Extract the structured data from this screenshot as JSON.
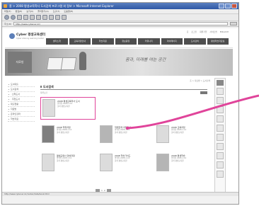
{
  "window": {
    "title": "홈 > 2008 평생교육학사 도서검색 프로그램 외 정보 > Microsoft Internet Explorer",
    "menu": [
      "파일(F)",
      "편집(E)",
      "보기(V)",
      "즐겨찾기(A)",
      "도구(T)",
      "도움말(H)"
    ]
  },
  "address": {
    "label": "주소(D)",
    "url": "http://www.cyber.ac.kr/",
    "go": "이동"
  },
  "site": {
    "logo_text": "Cyber 평생교육센터",
    "logo_sub": "Cyber Lifelong Learning Center",
    "util_links": [
      "홈",
      "로그인",
      "회원가입",
      "사이트맵",
      "ENGLISH"
    ],
    "gnb": [
      "센터소개",
      "교육과정안내",
      "학습지원",
      "정보광장",
      "커뮤니티",
      "마이페이지",
      "도서검색",
      "평생학습자료실"
    ],
    "section_badge": "자료방",
    "slogan": "꿈과, 미래를 여는 공간"
  },
  "lnb": [
    "도서대출",
    "도서검색",
    "· 신착도서",
    "· 추천도서",
    "대출현황",
    "자료방",
    "온라인강좌",
    "학습자료"
  ],
  "content": {
    "breadcrumb": "홈 > 자료방 > 도서검색",
    "title": "도서검색",
    "list_label": "목록보기",
    "books": [
      {
        "title": "2008 평생교육학사 도서",
        "meta1": "발행일 2008.1.14",
        "meta2": "출처 평생교육원"
      },
      {
        "title": "2008 학위과정",
        "meta1": "발행일 2008.1.14",
        "meta2": "출처 평생교육원"
      },
      {
        "title": "학위연계 과정안내",
        "meta1": "발행일 2008.1.14",
        "meta2": "출처 평생교육원"
      },
      {
        "title": "2008 교육과정",
        "meta1": "발행일 2008.1.14",
        "meta2": "출처 평생교육원"
      },
      {
        "title": "평생교육사 양성과정",
        "meta1": "발행일 2008.1.14",
        "meta2": "출처 평생교육원"
      },
      {
        "title": "2008 학습가이드",
        "meta1": "발행일 2008.1.14",
        "meta2": "출처 평생교육원"
      },
      {
        "title": "2008 평생학습",
        "meta1": "발행일 2008.1.14",
        "meta2": "출처 평생교육원"
      }
    ],
    "pager": [
      "1",
      "2"
    ]
  },
  "status": {
    "text": "http://www.cyber.ac.kr/center/data/book.html"
  },
  "colors": {
    "highlight": "#e0449a",
    "gnb": "#4e4e4e",
    "titlebar": "#2f58a4"
  }
}
